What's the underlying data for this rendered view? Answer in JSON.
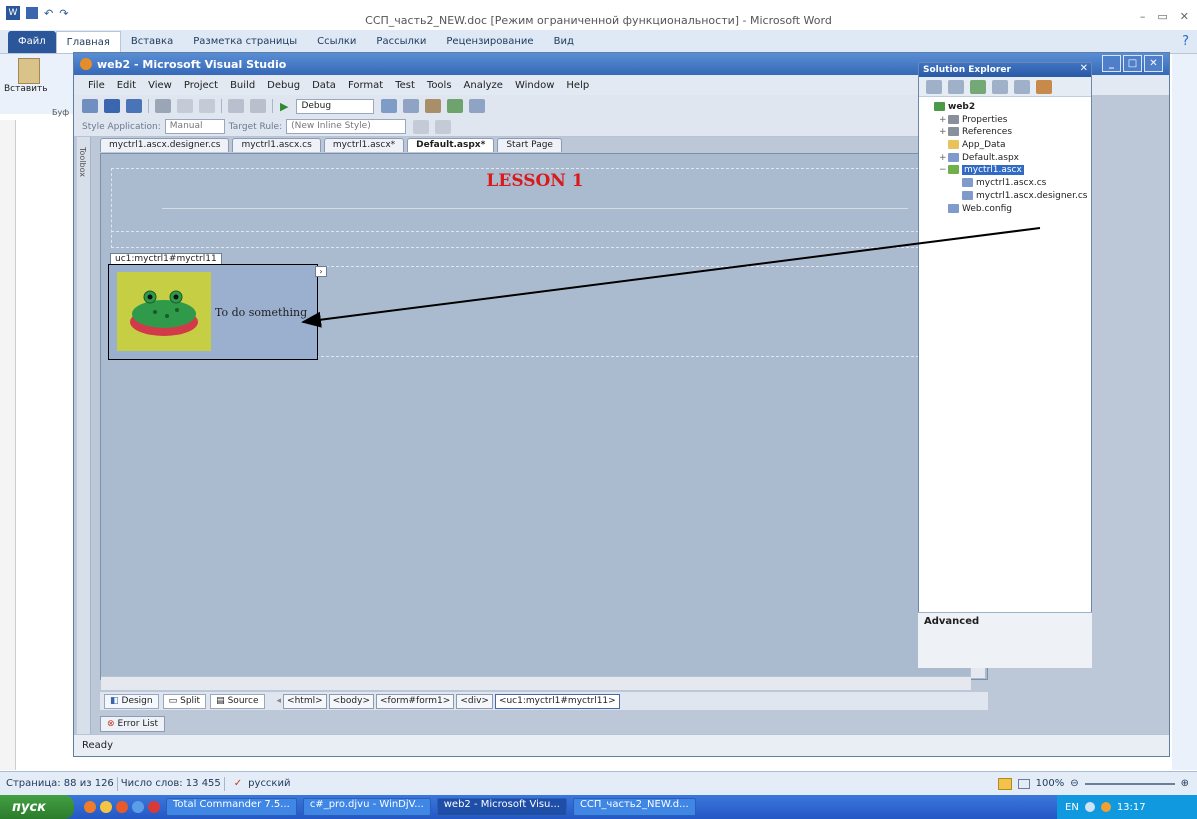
{
  "word": {
    "title": "ССП_часть2_NEW.doc [Режим ограниченной функциональности] - Microsoft Word",
    "tabs": [
      "Файл",
      "Главная",
      "Вставка",
      "Разметка страницы",
      "Ссылки",
      "Рассылки",
      "Рецензирование",
      "Вид"
    ],
    "paste_label": "Вставить",
    "clipboard_label": "Буф",
    "status": {
      "page": "Страница: 88 из 126",
      "words": "Число слов: 13 455",
      "language": "русский",
      "zoom": "100%"
    }
  },
  "vs": {
    "title": "web2 - Microsoft Visual Studio",
    "menu": [
      "File",
      "Edit",
      "View",
      "Project",
      "Build",
      "Debug",
      "Data",
      "Format",
      "Test",
      "Tools",
      "Analyze",
      "Window",
      "Help"
    ],
    "config": "Debug",
    "style_app_label": "Style Application:",
    "style_app_value": "Manual",
    "target_rule_label": "Target Rule:",
    "target_rule_value": "(New Inline Style)",
    "toolbox_label": "Toolbox",
    "doc_tabs": [
      "myctrl1.ascx.designer.cs",
      "myctrl1.ascx.cs",
      "myctrl1.ascx*",
      "Default.aspx*",
      "Start Page"
    ],
    "designer": {
      "heading": "LESSON 1",
      "uc_label": "uc1:myctrl1#myctrl11",
      "uc_text": "To do something"
    },
    "views": [
      "Design",
      "Split",
      "Source"
    ],
    "breadcrumbs": [
      "<html>",
      "<body>",
      "<form#form1>",
      "<div>",
      "<uc1:myctrl1#myctrl11>"
    ],
    "error_list": "Error List",
    "status": "Ready",
    "solution_explorer": {
      "title": "Solution Explorer",
      "items": [
        {
          "label": "web2",
          "indent": 0,
          "icon": "web-project-icon",
          "color": "#4a9a4a"
        },
        {
          "label": "Properties",
          "indent": 1,
          "icon": "properties-folder-icon",
          "color": "#8a8f9c"
        },
        {
          "label": "References",
          "indent": 1,
          "icon": "references-folder-icon",
          "color": "#8a8f9c"
        },
        {
          "label": "App_Data",
          "indent": 1,
          "icon": "folder-icon",
          "color": "#e8c35a"
        },
        {
          "label": "Default.aspx",
          "indent": 1,
          "icon": "aspx-file-icon",
          "color": "#7e9bcc"
        },
        {
          "label": "myctrl1.ascx",
          "indent": 1,
          "icon": "ascx-file-icon",
          "color": "#6fb04a",
          "selected": true
        },
        {
          "label": "myctrl1.ascx.cs",
          "indent": 2,
          "icon": "cs-file-icon",
          "color": "#7e9bcc"
        },
        {
          "label": "myctrl1.ascx.designer.cs",
          "indent": 2,
          "icon": "cs-file-icon",
          "color": "#7e9bcc"
        },
        {
          "label": "Web.config",
          "indent": 1,
          "icon": "config-file-icon",
          "color": "#7e9bcc"
        }
      ],
      "properties_label": "Advanced"
    }
  },
  "taskbar": {
    "start": "пуск",
    "items": [
      "Total Commander 7.5...",
      "c#_pro.djvu - WinDjV...",
      "web2 - Microsoft Visu...",
      "ССП_часть2_NEW.d..."
    ],
    "language": "EN",
    "clock": "13:17"
  }
}
